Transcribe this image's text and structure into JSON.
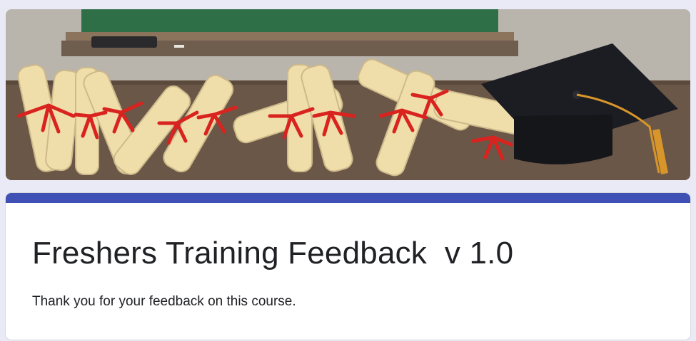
{
  "header_image": {
    "description_icon": "graduation-banner",
    "colors": {
      "chalkboard": "#2f6f48",
      "wall": "#b9b4ac",
      "desk": "#6b5748",
      "scroll": "#f0deaa",
      "ribbon": "#d9231f",
      "cap": "#1c1d22",
      "tassel": "#d8962a"
    }
  },
  "form": {
    "accent_color": "#3f51b5",
    "title": "Freshers Training Feedback  v 1.0",
    "description": "Thank you for your feedback on this course."
  }
}
